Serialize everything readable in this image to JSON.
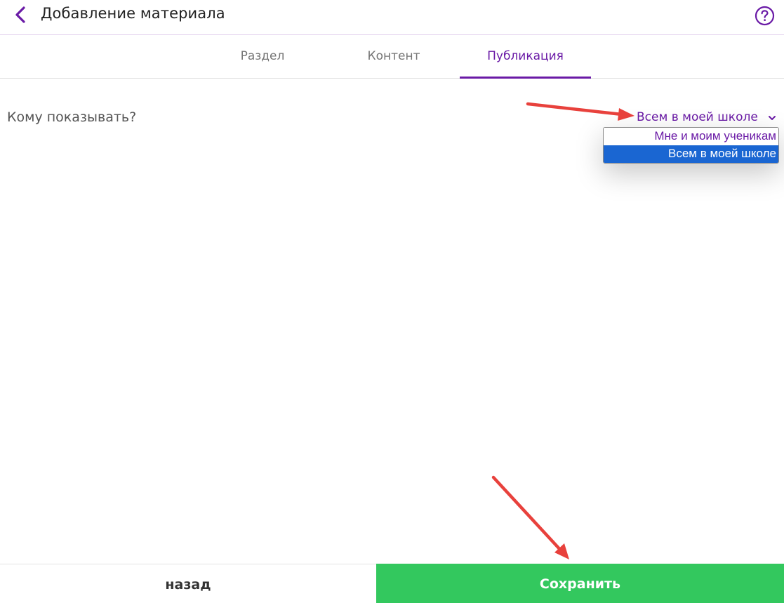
{
  "header": {
    "title": "Добавление материала",
    "back_icon": "chevron-left-icon",
    "help_icon": "question-circle-icon"
  },
  "tabs": [
    {
      "label": "Раздел",
      "active": false
    },
    {
      "label": "Контент",
      "active": false
    },
    {
      "label": "Публикация",
      "active": true
    }
  ],
  "visibility": {
    "question": "Кому показывать?",
    "selected": "Всем в моей школе",
    "options": [
      "Мне и моим ученикам",
      "Всем в моей школе"
    ]
  },
  "footer": {
    "back_label": "назад",
    "save_label": "Сохранить"
  },
  "colors": {
    "accent": "#6a1aa6",
    "save": "#33c85e",
    "option_highlight": "#1a66d2",
    "annotation_arrow": "#e8413c"
  }
}
